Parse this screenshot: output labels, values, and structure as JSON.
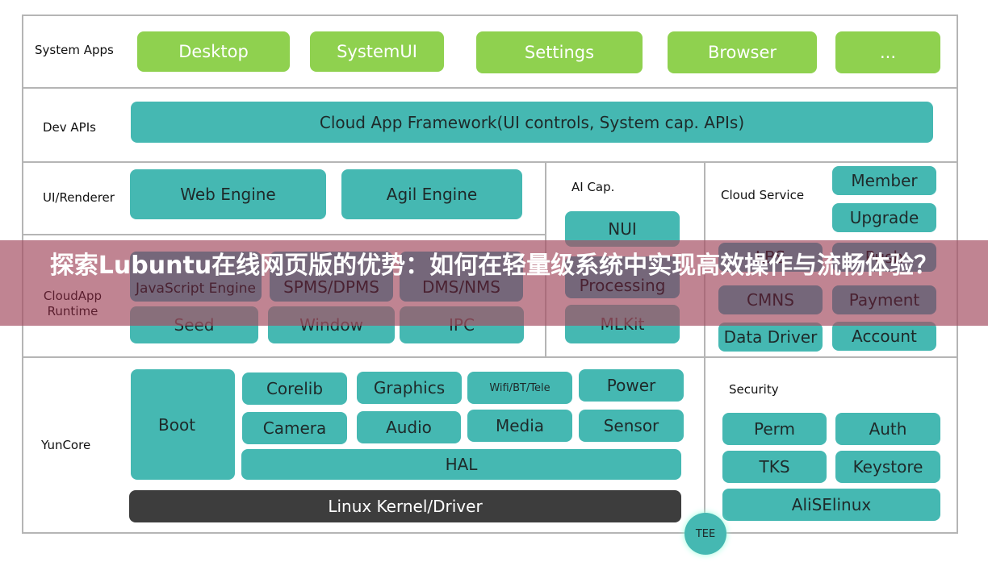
{
  "layers": {
    "system_apps": {
      "label": "System Apps",
      "items": [
        "Desktop",
        "SystemUI",
        "Settings",
        "Browser",
        "..."
      ]
    },
    "dev_apis": {
      "label": "Dev APIs",
      "items": [
        "Cloud App Framework(UI controls, System cap. APIs)"
      ]
    },
    "ui_renderer": {
      "label": "UI/Renderer",
      "items": [
        "Web Engine",
        "Agil Engine"
      ]
    },
    "cloudapp_runtime": {
      "label": "CloudApp Runtime",
      "items": [
        "JavaScript Engine",
        "SPMS/DPMS",
        "DMS/NMS",
        "Seed",
        "Window",
        "IPC"
      ]
    },
    "ai_cap": {
      "label": "AI Cap.",
      "items": [
        "NUI",
        "Processing",
        "MLKit"
      ]
    },
    "cloud_service": {
      "label": "Cloud Service",
      "items": [
        "Member",
        "Upgrade",
        "LBS",
        "Push",
        "CMNS",
        "Payment",
        "Data Driver",
        "Account"
      ]
    },
    "yuncore": {
      "label": "YunCore",
      "items": [
        "Boot",
        "Corelib",
        "Graphics",
        "Wifi/BT/Tele",
        "Power",
        "Camera",
        "Audio",
        "Media",
        "Sensor",
        "HAL",
        "Linux Kernel/Driver"
      ]
    },
    "security": {
      "label": "Security",
      "items": [
        "Perm",
        "Auth",
        "TKS",
        "Keystore",
        "AliSElinux"
      ]
    },
    "tee": "TEE"
  },
  "banner": {
    "title": "探索Lubuntu在线网页版的优势：如何在轻量级系统中实现高效操作与流畅体验？"
  },
  "colors": {
    "teal": "#45b8b2",
    "green": "#8fd14f",
    "dark": "#3d3d3d",
    "banner": "#a5506480"
  }
}
